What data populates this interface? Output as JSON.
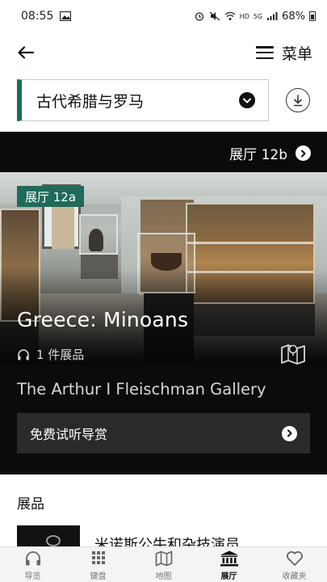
{
  "status_bar": {
    "time": "08:55",
    "network": "HD",
    "signal": "5G",
    "battery": "68%"
  },
  "header": {
    "menu_label": "菜单"
  },
  "gallery_selector": {
    "selected": "古代希腊与罗马"
  },
  "hero": {
    "next_room_label": "展厅 12b",
    "room_badge": "展厅 12a",
    "title": "Greece: Minoans",
    "exhibit_count": "1 件展品",
    "subtitle": "The Arthur I Fleischman Gallery",
    "listen_button": "免费试听导赏"
  },
  "exhibits": {
    "heading": "展品",
    "items": [
      {
        "title": "米诺斯公牛和杂技演员"
      }
    ]
  },
  "bottom_nav": {
    "items": [
      {
        "label": "导览",
        "icon": "headphones-icon"
      },
      {
        "label": "键盘",
        "icon": "keypad-icon"
      },
      {
        "label": "地图",
        "icon": "map-icon"
      },
      {
        "label": "展厅",
        "icon": "museum-icon",
        "active": true
      },
      {
        "label": "收藏夹",
        "icon": "heart-icon"
      }
    ]
  },
  "colors": {
    "accent": "#1f6b5b",
    "hero_bg": "#0b0b0b",
    "button_bg": "#2a2a2a"
  }
}
